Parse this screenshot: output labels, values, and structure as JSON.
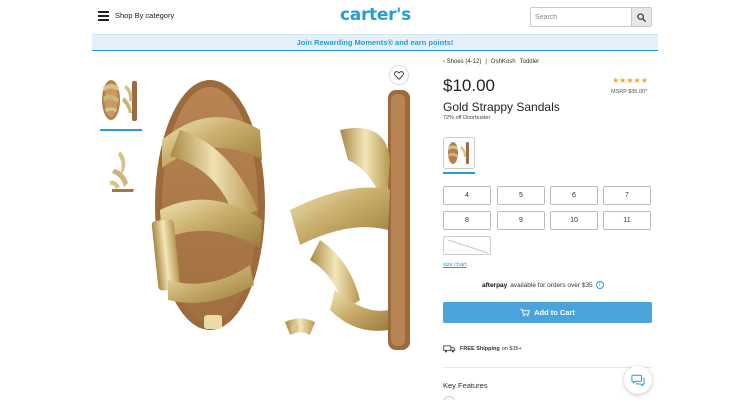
{
  "header": {
    "menu_label": "Shop By category",
    "logo": "carter's",
    "search_placeholder": "Search"
  },
  "promo": {
    "text": "Join Rewarding Moments® and earn points!"
  },
  "breadcrumb": [
    "‹ Shoes (4-12)",
    "OshKosh",
    "Toddler"
  ],
  "product": {
    "price": "$10.00",
    "rating_stars": "★★★★★",
    "rating_value": 5,
    "msrp": "MSRP $35.00*",
    "title": "Gold Strappy Sandals",
    "discount": "72% off Doorbuster",
    "sizes": [
      "4",
      "5",
      "6",
      "7",
      "8",
      "9",
      "10",
      "11"
    ],
    "size_chart_label": "size chart",
    "afterpay_logo": "afterpay",
    "afterpay_text": "available for orders over $35",
    "add_to_cart": "Add to Cart",
    "shipping_label": "FREE Shipping",
    "shipping_text": "on $35+",
    "key_features": "Key Features"
  },
  "icons": {
    "menu": "hamburger-icon",
    "search": "search-icon",
    "favorite": "heart-icon",
    "info": "info-icon",
    "cart": "cart-icon",
    "truck": "truck-icon",
    "chat": "chat-icon"
  },
  "colors": {
    "brand": "#2a9bd6",
    "button": "#4ba3dc",
    "star": "#f5a623",
    "banner_bg": "#e5f1fa"
  }
}
